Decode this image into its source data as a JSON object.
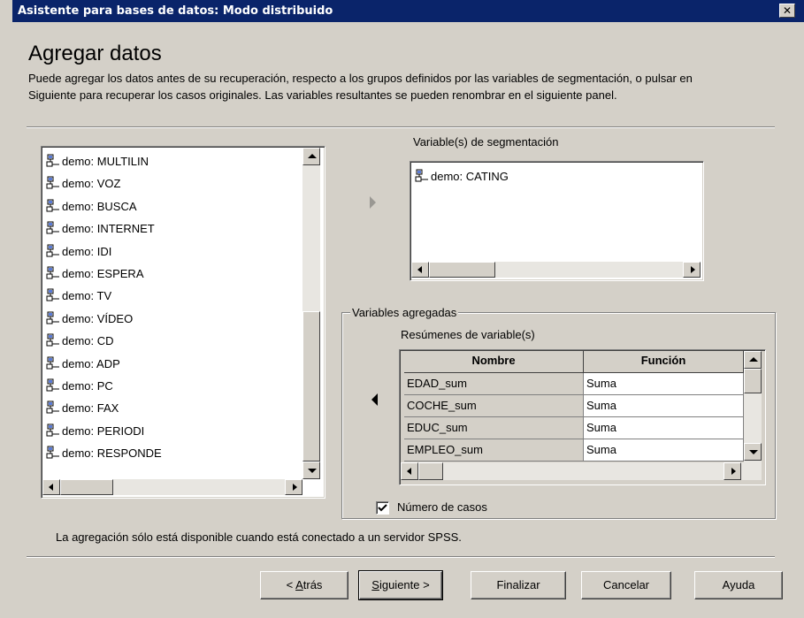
{
  "window": {
    "title": "Asistente para bases de datos: Modo distribuido",
    "close_glyph": "✕"
  },
  "header": {
    "title": "Agregar datos",
    "description": "Puede agregar los datos antes de su recuperación, respecto a los grupos definidos por las variables de segmentación, o pulsar en Siguiente para recuperar los casos originales. Las variables resultantes se pueden renombrar en el siguiente panel."
  },
  "source_list": {
    "items": [
      "demo: MULTILIN",
      "demo: VOZ",
      "demo: BUSCA",
      "demo: INTERNET",
      "demo: IDI",
      "demo: ESPERA",
      "demo: TV",
      "demo: VÍDEO",
      "demo: CD",
      "demo: ADP",
      "demo: PC",
      "demo: FAX",
      "demo: PERIODI",
      "demo: RESPONDE"
    ],
    "item_icon": "database-field-icon"
  },
  "segmentation": {
    "label": "Variable(s) de segmentación",
    "items": [
      "demo: CATING"
    ]
  },
  "aggregated": {
    "group_label": "Variables agregadas",
    "summaries_label": "Resúmenes de variable(s)",
    "columns": [
      "Nombre",
      "Función"
    ],
    "rows": [
      [
        "EDAD_sum",
        "Suma"
      ],
      [
        "COCHE_sum",
        "Suma"
      ],
      [
        "EDUC_sum",
        "Suma"
      ],
      [
        "EMPLEO_sum",
        "Suma"
      ]
    ],
    "case_count_label": "Número de casos",
    "case_count_checked": true
  },
  "footer_note": "La agregación sólo está disponible cuando está conectado a un servidor SPSS.",
  "buttons": {
    "back": {
      "prefix": "< ",
      "mnemonic": "A",
      "rest": "trás"
    },
    "next": {
      "mnemonic": "S",
      "rest": "iguiente >"
    },
    "finish": "Finalizar",
    "cancel": "Cancelar",
    "help": "Ayuda"
  },
  "colors": {
    "titlebar": "#0a246a",
    "face": "#d4d0c8"
  }
}
